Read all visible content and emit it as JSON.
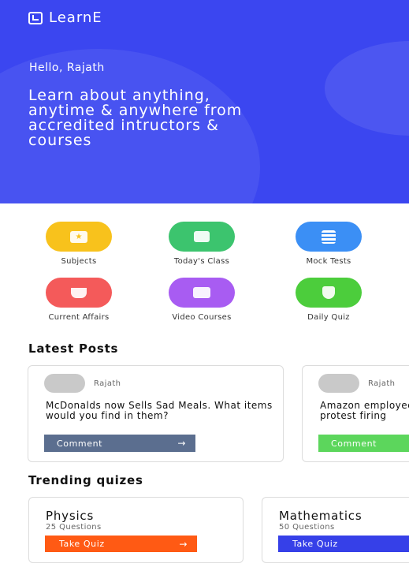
{
  "app": {
    "name": "LearnE"
  },
  "hero": {
    "greeting": "Hello, Rajath",
    "tagline": "Learn about anything, anytime & anywhere from accredited intructors & courses"
  },
  "categories": [
    {
      "label": "Subjects",
      "icon": "star-card-icon",
      "color": "#f8c21c"
    },
    {
      "label": "Today's Class",
      "icon": "presentation-board-icon",
      "color": "#3cc46e"
    },
    {
      "label": "Mock Tests",
      "icon": "clipboard-icon",
      "color": "#3b8ff5"
    },
    {
      "label": "Current Affairs",
      "icon": "coffee-cup-icon",
      "color": "#f45a5a"
    },
    {
      "label": "Video Courses",
      "icon": "video-camera-icon",
      "color": "#a85cf2"
    },
    {
      "label": "Daily Quiz",
      "icon": "trophy-icon",
      "color": "#4ccd3c"
    }
  ],
  "latest_posts": {
    "title": "Latest Posts",
    "items": [
      {
        "author": "Rajath",
        "text": "McDonalds now Sells Sad Meals. What items would you find in them?",
        "button": "Comment",
        "button_color": "#5b6e8f"
      },
      {
        "author": "Rajath",
        "text": "Amazon employees plan ‘online walkout’ to protest firing",
        "button": "Comment",
        "button_color": "#5cd65c"
      }
    ]
  },
  "trending": {
    "title": "Trending quizes",
    "items": [
      {
        "name": "Physics",
        "count": "25 Questions",
        "button": "Take Quiz",
        "button_color": "#ff5a14"
      },
      {
        "name": "Mathematics",
        "count": "50 Questions",
        "button": "Take Quiz",
        "button_color": "#3640e8"
      }
    ]
  },
  "colors": {
    "primary": "#3b46f0"
  }
}
